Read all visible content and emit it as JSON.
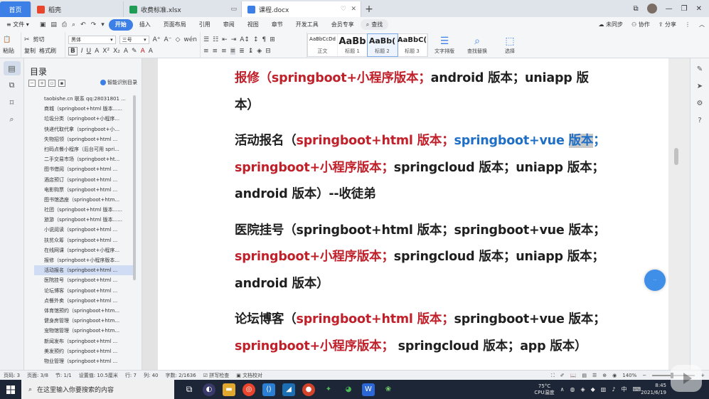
{
  "tabs": [
    {
      "label": "首页",
      "type": "home"
    },
    {
      "label": "稻壳",
      "type": "docer",
      "color": "#e8452c"
    },
    {
      "label": "收费标准.xlsx",
      "type": "xlsx",
      "color": "#1f9d55"
    },
    {
      "label": "课程.docx",
      "type": "docx",
      "color": "#3c7fe6",
      "active": true
    }
  ],
  "menu": {
    "file": "文件",
    "items": [
      "开始",
      "插入",
      "页面布局",
      "引用",
      "审阅",
      "视图",
      "章节",
      "开发工具",
      "会员专享"
    ],
    "search": "查找",
    "right": [
      "未同步",
      "协作",
      "分享"
    ]
  },
  "ribbon": {
    "cut": "剪切",
    "paste": "粘贴",
    "copy": "复制",
    "format_painter": "格式刷",
    "font_name": "黑体",
    "font_size": "三号",
    "styles": [
      {
        "preview": "AaBbCcDd",
        "name": "正文"
      },
      {
        "preview": "AaBb",
        "name": "标题 1"
      },
      {
        "preview": "AaBb(",
        "name": "标题 2"
      },
      {
        "preview": "AaBbC(",
        "name": "标题 3"
      }
    ],
    "text_layout": "文字排版",
    "find_replace": "查找替换",
    "select": "选择"
  },
  "toc": {
    "title": "目录",
    "smart": "智能识别目录",
    "items": [
      "taobishe.cn 联系 qq:28031801 ...",
      "商城（springboot+html 版本......",
      "垃圾分类（springboot+小程序...",
      "快递代取代拿（springboot+小...",
      "失物招领（springboot+html ...",
      "扫码点餐小程序（后台可用 spri...",
      "二手交易市场（springboot+ht...",
      "图书借阅（springboot+html ...",
      "酒店预订（springboot+html ...",
      "电影购票（springboot+html ...",
      "图书馆选座（springboot+htm...",
      "社团（springboot+html 版本......",
      "旅游（springboot+html 版本......",
      "小说阅读（springboot+html ...",
      "扶贫众筹（springboot+html ...",
      "在线网课（springboot+小程序...",
      "报修（springboot+小程序版本...",
      "活动报名（springboot+html ...",
      "医院挂号（springboot+html ...",
      "论坛博客（springboot+html ...",
      "点餐外卖（springboot+html ...",
      "体育馆预约（springboot+htm...",
      "健身房管理（springboot+htm...",
      "宠物馆管理（springboot+htm...",
      "新闻发布（springboot+html ...",
      "美发预约（springboot+html ...",
      "物业管理（springboot+html ..."
    ],
    "selected_index": 17
  },
  "document": {
    "lines": [
      [
        {
          "t": "报修（springboot+小程序版本；",
          "c": "red"
        },
        {
          "t": "android 版本；uniapp 版",
          "c": "black"
        }
      ],
      [
        {
          "t": "本）",
          "c": "black"
        }
      ],
      [],
      [
        {
          "t": "活动报名（",
          "c": "black"
        },
        {
          "t": "springboot+html 版本；",
          "c": "red"
        },
        {
          "t": "springboot+vue ",
          "c": "blue"
        },
        {
          "t": "版本",
          "c": "blue-hl"
        },
        {
          "t": "；",
          "c": "blue"
        }
      ],
      [
        {
          "t": "springboot+小程序版本；",
          "c": "red"
        },
        {
          "t": "springcloud 版本；uniapp 版本；",
          "c": "black"
        }
      ],
      [
        {
          "t": "android 版本）--收徒弟",
          "c": "black"
        }
      ],
      [],
      [
        {
          "t": "医院挂号（springboot+html 版本；springboot+vue 版本；",
          "c": "black"
        }
      ],
      [
        {
          "t": "springboot+小程序版本；",
          "c": "red"
        },
        {
          "t": "springcloud 版本；uniapp 版本；",
          "c": "black"
        }
      ],
      [
        {
          "t": "android 版本）",
          "c": "black"
        }
      ],
      [],
      [
        {
          "t": "论坛博客（",
          "c": "black"
        },
        {
          "t": "springboot+html 版本；",
          "c": "red"
        },
        {
          "t": "springboot+vue 版本；",
          "c": "black"
        }
      ],
      [
        {
          "t": "springboot+小程序版本；",
          "c": "red"
        },
        {
          "t": " springcloud 版本；app 版本）",
          "c": "black"
        }
      ]
    ]
  },
  "status": {
    "items": [
      "页码: 3",
      "页面: 3/8",
      "节: 1/1",
      "设置值: 10.5厘米",
      "行: 7",
      "列: 40",
      "字数: 2/1636",
      "拼写检查",
      "文档校对"
    ],
    "zoom": "140%"
  },
  "taskbar": {
    "search_placeholder": "在这里输入你要搜索的内容",
    "cpu_temp": "75°C",
    "cpu_label": "CPU温度",
    "ime": "中",
    "time": "8:45",
    "date": "2021/6/19"
  },
  "colors": {
    "accent": "#3c7fe6",
    "red_text": "#c0202a",
    "blue_text": "#1f6fc6"
  }
}
